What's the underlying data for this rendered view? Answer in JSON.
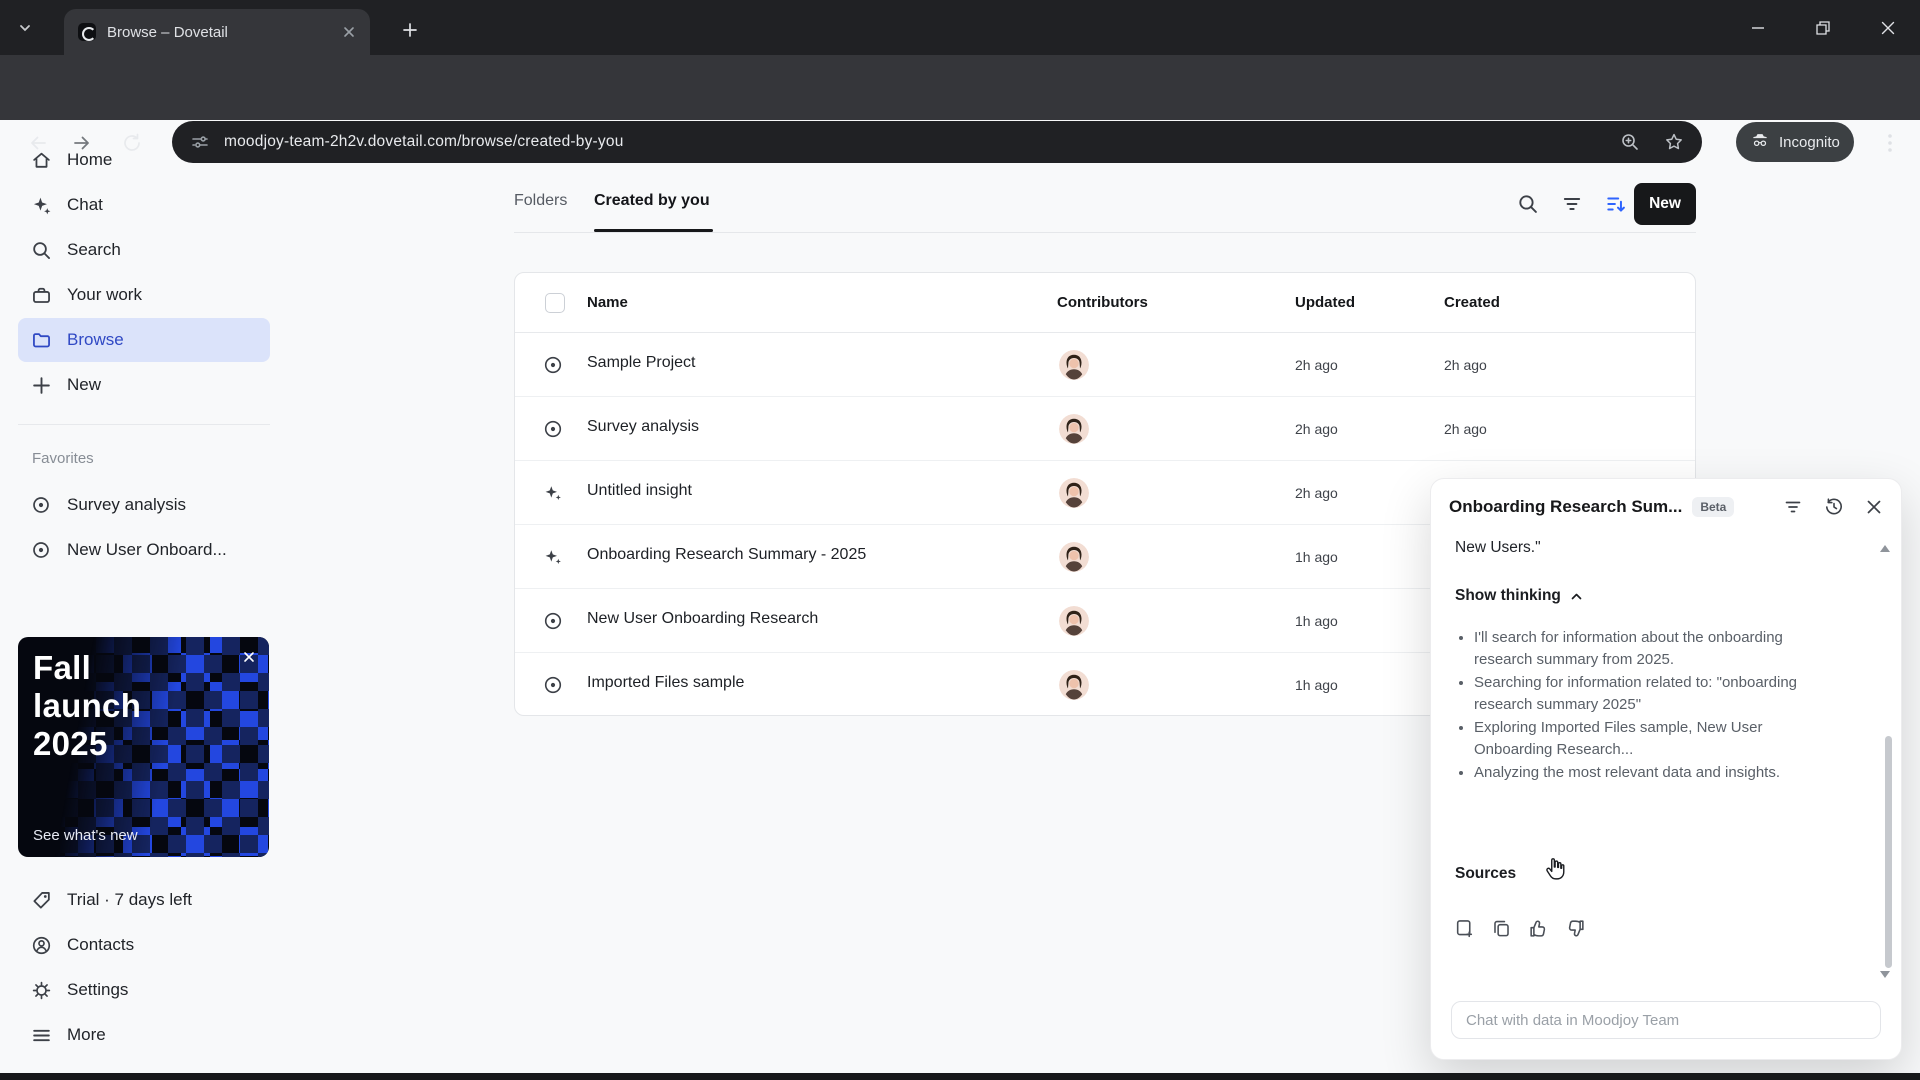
{
  "browser": {
    "tab_title": "Browse – Dovetail",
    "url": "moodjoy-team-2h2v.dovetail.com/browse/created-by-you",
    "incognito_label": "Incognito"
  },
  "sidebar": {
    "items": [
      {
        "label": "Home",
        "icon": "home-icon"
      },
      {
        "label": "Chat",
        "icon": "sparkle-icon"
      },
      {
        "label": "Search",
        "icon": "search-icon"
      },
      {
        "label": "Your work",
        "icon": "briefcase-icon"
      },
      {
        "label": "Browse",
        "icon": "folder-icon",
        "active": true
      },
      {
        "label": "New",
        "icon": "plus-icon"
      }
    ],
    "favorites_label": "Favorites",
    "favorites": [
      {
        "label": "Survey analysis"
      },
      {
        "label": "New User Onboard..."
      }
    ],
    "promo": {
      "title_lines": [
        "Fall",
        "launch",
        "2025"
      ],
      "link": "See what's new"
    },
    "footer": [
      {
        "label": "Trial · 7 days left",
        "icon": "tag-icon"
      },
      {
        "label": "Contacts",
        "icon": "contacts-icon"
      },
      {
        "label": "Settings",
        "icon": "gear-icon"
      },
      {
        "label": "More",
        "icon": "menu-icon"
      }
    ]
  },
  "main": {
    "tabs": [
      {
        "label": "Folders",
        "active": false
      },
      {
        "label": "Created by you",
        "active": true
      }
    ],
    "new_button": "New",
    "table": {
      "headers": [
        "Name",
        "Contributors",
        "Updated",
        "Created"
      ],
      "rows": [
        {
          "name": "Sample Project",
          "icon": "project-target-icon",
          "updated": "2h ago",
          "created": "2h ago"
        },
        {
          "name": "Survey analysis",
          "icon": "project-target-icon",
          "updated": "2h ago",
          "created": "2h ago"
        },
        {
          "name": "Untitled insight",
          "icon": "insight-sparkle-icon",
          "updated": "2h ago",
          "created": ""
        },
        {
          "name": "Onboarding Research Summary - 2025",
          "icon": "insight-sparkle-icon",
          "updated": "1h ago",
          "created": ""
        },
        {
          "name": "New User Onboarding Research",
          "icon": "project-target-icon",
          "updated": "1h ago",
          "created": ""
        },
        {
          "name": "Imported Files sample",
          "icon": "project-target-icon",
          "updated": "1h ago",
          "created": ""
        }
      ]
    }
  },
  "chat": {
    "title": "Onboarding Research Sum...",
    "beta_badge": "Beta",
    "quote": "New Users.\"",
    "show_thinking": "Show thinking",
    "steps": [
      "I'll search for information about the onboarding research summary from 2025.",
      "Searching for information related to: \"onboarding research summary 2025\"",
      "Exploring Imported Files sample, New User Onboarding Research...",
      "Analyzing the most relevant data and insights."
    ],
    "sources_label": "Sources",
    "input_placeholder": "Chat with data in Moodjoy Team"
  },
  "colors": {
    "accent_blue": "#3049c4",
    "accent_blue_bg": "#dbe3fa",
    "sort_icon_blue": "#2e64fe",
    "primary_button": "#17181a",
    "chrome_dark": "#202124",
    "chrome_toolbar": "#35363a",
    "page_bg": "#f8f9fa"
  }
}
